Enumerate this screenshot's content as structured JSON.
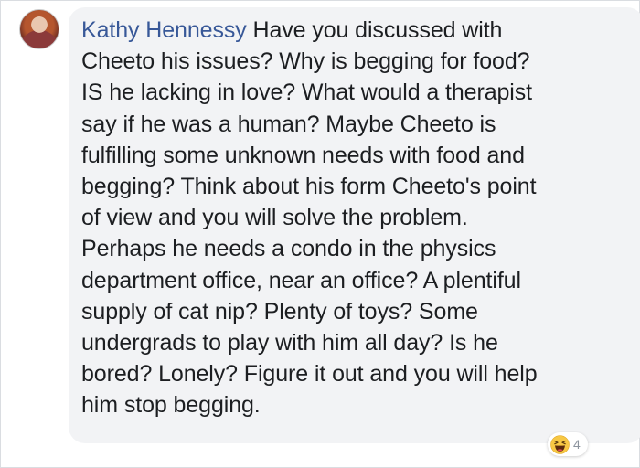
{
  "comment": {
    "author": "Kathy Hennessy",
    "lines": [
      "Have you discussed with",
      "Cheeto his issues? Why is begging for food?",
      "IS he lacking in love? What would a therapist",
      "say if he was a human? Maybe Cheeto is",
      "fulfilling some unknown needs with food and",
      "begging? Think about his form Cheeto's point",
      "of view and you will solve the problem.",
      "Perhaps he needs a condo in the physics",
      "department office, near an office? A plentiful",
      "supply of cat nip? Plenty of toys? Some",
      "undergrads to play with him all day? Is he",
      "bored? Lonely? Figure it out and you will help",
      "him stop begging."
    ]
  },
  "reaction": {
    "icon": "haha-emoji-icon",
    "count": "4"
  },
  "colors": {
    "author_link": "#385898",
    "bubble_bg": "#f2f3f5",
    "text": "#1c1e21",
    "count": "#8d949e"
  }
}
